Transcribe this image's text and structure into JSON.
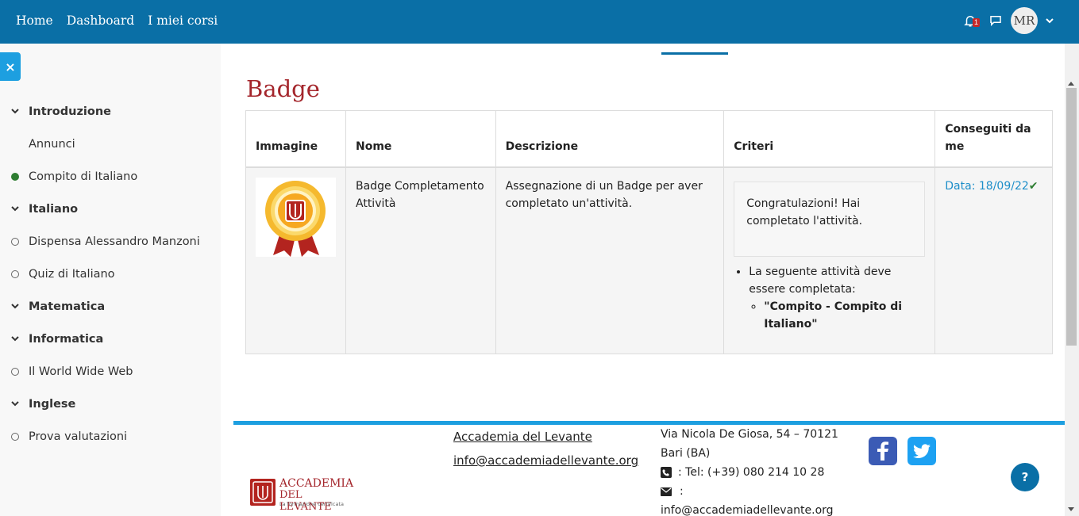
{
  "navbar": {
    "links": [
      "Home",
      "Dashboard",
      "I miei corsi"
    ],
    "notification_count": "1",
    "user_initials": "MR"
  },
  "sidebar": {
    "close_icon": "×",
    "items": [
      {
        "label": "Introduzione",
        "type": "section"
      },
      {
        "label": "Annunci",
        "type": "plain"
      },
      {
        "label": "Compito di Italiano",
        "type": "done"
      },
      {
        "label": "Italiano",
        "type": "section"
      },
      {
        "label": "Dispensa Alessandro Manzoni",
        "type": "todo"
      },
      {
        "label": "Quiz di Italiano",
        "type": "todo"
      },
      {
        "label": "Matematica",
        "type": "section"
      },
      {
        "label": "Informatica",
        "type": "section"
      },
      {
        "label": "Il World Wide Web",
        "type": "todo"
      },
      {
        "label": "Inglese",
        "type": "section"
      },
      {
        "label": "Prova valutazioni",
        "type": "todo"
      }
    ]
  },
  "main": {
    "title": "Badge",
    "table": {
      "headers": {
        "image": "Immagine",
        "name": "Nome",
        "description": "Descrizione",
        "criteria": "Criteri",
        "earned": "Conseguiti da me"
      },
      "row": {
        "name": "Badge Completamento Attività",
        "description": "Assegnazione di un Badge per aver completato un'attività.",
        "criteria_message": "Congratulazioni! Hai completato l'attività.",
        "criteria_rule": "La seguente attività deve essere completata:",
        "criteria_activity": "\"Compito - Compito di Italiano\"",
        "earned_date": "Data: 18/09/22",
        "check": "✔"
      }
    }
  },
  "footer": {
    "org_name": "Accademia del Levante",
    "email_link": "info@accademiadellevante.org",
    "address_line1": "Via Nicola De Giosa, 54 – 70121",
    "address_line2": "Bari (BA)",
    "phone": ": Tel: (+39) 080 214 10 28",
    "email_label": ":",
    "email_text": "info@accademiadellevante.org",
    "logo_line1": "ACCADEMIA",
    "logo_line2": "DEL LEVANTE",
    "logo_tagline": "La formazione certificata"
  },
  "help_label": "?",
  "colors": {
    "navbar": "#0a6fa6",
    "accent": "#1d9fe0",
    "title": "#a4262c"
  }
}
